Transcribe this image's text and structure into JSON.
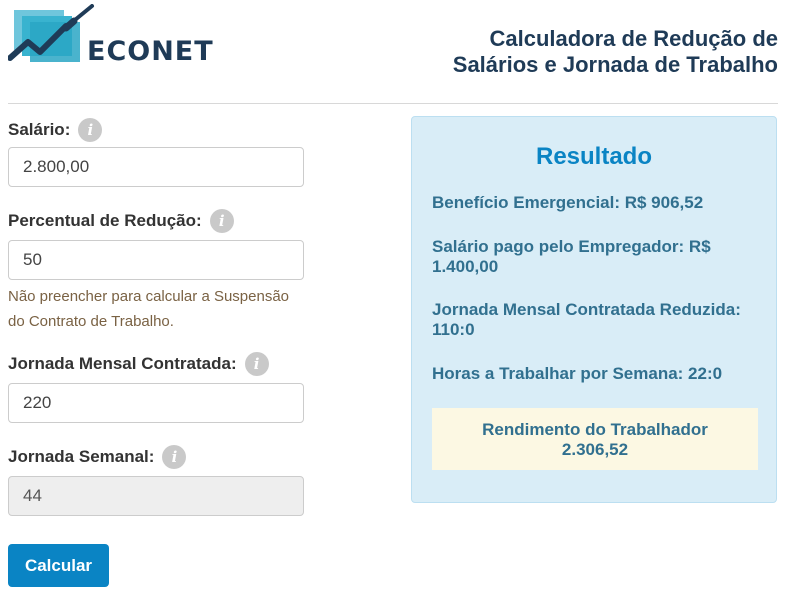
{
  "header": {
    "logo_text": "ECONET",
    "title_line1": "Calculadora de Redução de",
    "title_line2": "Salários e Jornada de Trabalho"
  },
  "form": {
    "salario": {
      "label": "Salário:",
      "value": "2.800,00",
      "icon": "info-icon"
    },
    "percentual": {
      "label": "Percentual de Redução:",
      "value": "50",
      "icon": "info-icon",
      "hint": "Não preencher para calcular a Suspensão do Contrato de Trabalho."
    },
    "jornada_mensal": {
      "label": "Jornada Mensal Contratada:",
      "value": "220",
      "icon": "info-icon"
    },
    "jornada_semanal": {
      "label": "Jornada Semanal:",
      "value": "44",
      "icon": "info-icon"
    },
    "button_label": "Calcular"
  },
  "result": {
    "title": "Resultado",
    "beneficio": "Benefício Emergencial: R$ 906,52",
    "salario_empregador": "Salário pago pelo Empregador: R$ 1.400,00",
    "jornada_reduzida": "Jornada Mensal Contratada Reduzida: 110:0",
    "horas_semana": "Horas a Trabalhar por Semana: 22:0",
    "rendimento_label": "Rendimento do Trabalhador",
    "rendimento_value": "2.306,52"
  },
  "colors": {
    "accent": "#0a84c4",
    "title": "#1f3b57",
    "result_bg": "#d9edf7",
    "result_text": "#31708f",
    "highlight_bg": "#fcf8e3"
  }
}
